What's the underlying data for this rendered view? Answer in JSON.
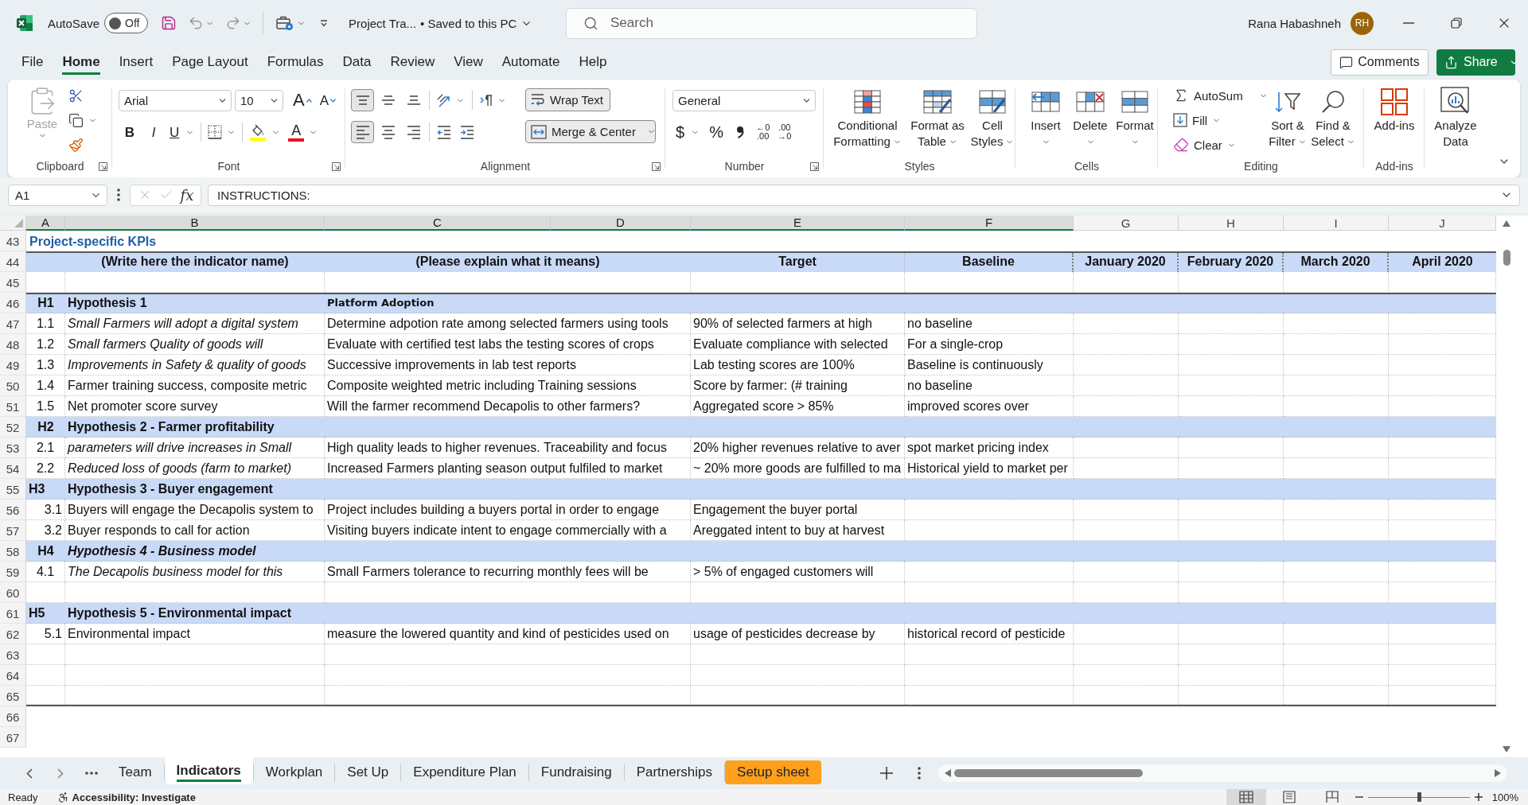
{
  "title_bar": {
    "autosave": "AutoSave",
    "autosave_toggle": {
      "label": "Off",
      "on": false
    },
    "document": "Project Tra...",
    "save_status": "• Saved to this PC",
    "search": {
      "placeholder": "Search"
    },
    "user": {
      "name": "Rana Habashneh",
      "initials": "RH"
    }
  },
  "menu": {
    "tabs": [
      {
        "label": "File",
        "selected": false
      },
      {
        "label": "Home",
        "selected": true
      },
      {
        "label": "Insert",
        "selected": false
      },
      {
        "label": "Page Layout",
        "selected": false
      },
      {
        "label": "Formulas",
        "selected": false
      },
      {
        "label": "Data",
        "selected": false
      },
      {
        "label": "Review",
        "selected": false
      },
      {
        "label": "View",
        "selected": false
      },
      {
        "label": "Automate",
        "selected": false
      },
      {
        "label": "Help",
        "selected": false
      }
    ],
    "comments": "Comments",
    "share": "Share"
  },
  "ribbon": {
    "clipboard": {
      "label": "Clipboard",
      "paste": {
        "label": "Paste",
        "disabled": true
      }
    },
    "font": {
      "label": "Font",
      "name": "Arial",
      "size": "10",
      "grow": "A",
      "shrink": "A",
      "bold": "B",
      "italic": "I",
      "underline": "U",
      "font_color": "A"
    },
    "alignment": {
      "label": "Alignment",
      "vertical": [
        {
          "kind": "top",
          "pressed": true
        },
        {
          "kind": "middle",
          "pressed": false
        },
        {
          "kind": "bottom",
          "pressed": false
        }
      ],
      "horizontal": [
        {
          "kind": "left",
          "pressed": true
        },
        {
          "kind": "center",
          "pressed": false
        },
        {
          "kind": "right",
          "pressed": false
        }
      ],
      "wrap_text": {
        "label": "Wrap Text",
        "pressed": true
      },
      "merge": {
        "label": "Merge & Center",
        "pressed": true
      }
    },
    "number": {
      "label": "Number",
      "format": "General",
      "currency": "$",
      "percent": "%",
      "decimals": [
        {
          "upper": "←0",
          "lower": ".00"
        },
        {
          "upper": ".00",
          "lower": "→0"
        }
      ]
    },
    "styles": {
      "label": "Styles",
      "buttons": [
        {
          "kind": "conditional",
          "lines": [
            "Conditional",
            "Formatting"
          ]
        },
        {
          "kind": "table",
          "lines": [
            "Format as",
            "Table"
          ]
        },
        {
          "kind": "cell_styles",
          "lines": [
            "Cell",
            "Styles"
          ]
        }
      ]
    },
    "cells": {
      "label": "Cells",
      "buttons": [
        {
          "kind": "insert",
          "label": "Insert"
        },
        {
          "kind": "delete",
          "label": "Delete"
        },
        {
          "kind": "format",
          "label": "Format"
        }
      ]
    },
    "editing": {
      "label": "Editing",
      "small": [
        {
          "kind": "autosum",
          "label": "AutoSum"
        },
        {
          "kind": "fill",
          "label": "Fill"
        },
        {
          "kind": "clear",
          "label": "Clear"
        }
      ],
      "large": [
        {
          "kind": "sort",
          "lines": [
            "Sort &",
            "Filter"
          ]
        },
        {
          "kind": "find",
          "lines": [
            "Find &",
            "Select"
          ]
        }
      ]
    },
    "addins": {
      "label": "Add-ins",
      "button": "Add-ins"
    },
    "analyze": {
      "lines": [
        "Analyze",
        "Data"
      ]
    }
  },
  "formula_bar": {
    "name_box": "A1",
    "fx": "fx",
    "formula": "INSTRUCTIONS:"
  },
  "sheet": {
    "columns": [
      {
        "label": "A",
        "selected": true
      },
      {
        "label": "B",
        "selected": true
      },
      {
        "label": "C",
        "selected": true
      },
      {
        "label": "D",
        "selected": true
      },
      {
        "label": "E",
        "selected": true
      },
      {
        "label": "F",
        "selected": true
      },
      {
        "label": "G",
        "selected": false
      },
      {
        "label": "H",
        "selected": false
      },
      {
        "label": "I",
        "selected": false
      },
      {
        "label": "J",
        "selected": false
      }
    ],
    "rows": [
      {
        "number": "43",
        "kind": "title",
        "a": "Project-specific KPIs"
      },
      {
        "number": "44",
        "kind": "header",
        "thick_top": true,
        "b": "(Write here the indicator name)",
        "c": "(Please explain what it means)",
        "e": "Target",
        "f": "Baseline",
        "g": "January 2020",
        "h": "February 2020",
        "i": "March 2020",
        "j": "April 2020"
      },
      {
        "number": "45",
        "kind": "blank"
      },
      {
        "number": "46",
        "kind": "group",
        "thick_top": true,
        "a": "H1",
        "a_centered": true,
        "b": "Hypothesis 1",
        "b_italic": false,
        "c": "Platform Adoption"
      },
      {
        "number": "47",
        "kind": "item",
        "a": "1.1",
        "a_centered": true,
        "b": "Small Farmers will adopt a digital system",
        "b_italic": true,
        "c": "Determine adpotion rate among selected farmers using tools",
        "e": "90% of selected farmers at high",
        "f": "no baseline"
      },
      {
        "number": "48",
        "kind": "item",
        "a": "1.2",
        "a_centered": true,
        "b": "Small farmers Quality of goods will",
        "b_italic": true,
        "c": "Evaluate with certified test labs the testing scores of crops",
        "e": "Evaluate compliance with selected",
        "f": "For a single-crop"
      },
      {
        "number": "49",
        "kind": "item",
        "a": "1.3",
        "a_centered": true,
        "b": "Improvements in Safety & quality of goods",
        "b_italic": true,
        "c": "Successive improvements in lab test reports",
        "e": "Lab testing scores are 100%",
        "f": "Baseline is continuously"
      },
      {
        "number": "50",
        "kind": "item",
        "a": "1.4",
        "a_centered": true,
        "b": "Farmer training success, composite metric",
        "b_italic": false,
        "c": "Composite weighted metric including Training sessions",
        "e": "Score by farmer: (# training",
        "f": "no baseline"
      },
      {
        "number": "51",
        "kind": "item",
        "a": "1.5",
        "a_centered": true,
        "b": "Net promoter score survey",
        "b_italic": false,
        "c": "Will the farmer recommend Decapolis to other farmers?",
        "e": "Aggregated score > 85%",
        "f": "improved scores over"
      },
      {
        "number": "52",
        "kind": "group",
        "a": "H2",
        "a_centered": true,
        "b": "Hypothesis 2 - Farmer profitability",
        "b_italic": false
      },
      {
        "number": "53",
        "kind": "item",
        "a": "2.1",
        "a_centered": true,
        "b": "parameters will drive increases in Small",
        "b_italic": true,
        "c": "High quality leads to higher revenues. Traceability and focus",
        "e": "20% higher revenues relative to aver",
        "f": "spot market pricing index"
      },
      {
        "number": "54",
        "kind": "item",
        "a": "2.2",
        "a_centered": true,
        "b": "Reduced loss of goods (farm to market)",
        "b_italic": true,
        "c": "Increased Farmers planting season output fulfiled to market",
        "e": "~ 20% more goods are fulfilled to ma",
        "f": "Historical yield to market per"
      },
      {
        "number": "55",
        "kind": "group",
        "a": "H3",
        "a_centered": false,
        "b": "Hypothesis 3 - Buyer engagement",
        "b_italic": false
      },
      {
        "number": "56",
        "kind": "item",
        "a": "3.1",
        "a_centered": false,
        "b": "Buyers will engage the Decapolis system to",
        "b_italic": false,
        "c": "Project includes building a buyers portal in order to engage",
        "e": "Engagement the buyer portal"
      },
      {
        "number": "57",
        "kind": "item",
        "a": "3.2",
        "a_centered": false,
        "b": "Buyer responds to call for action",
        "b_italic": false,
        "c": "Visiting buyers indicate intent to engage commercially with a",
        "e": "Areggated intent to buy at harvest"
      },
      {
        "number": "58",
        "kind": "group",
        "a": "H4",
        "a_centered": true,
        "b": "Hypothesis 4 - Business model",
        "b_italic": true
      },
      {
        "number": "59",
        "kind": "item",
        "a": "4.1",
        "a_centered": true,
        "b": "The Decapolis business model for this",
        "b_italic": true,
        "c": "Small Farmers tolerance to recurring monthly fees will be",
        "e": "> 5% of engaged customers will"
      },
      {
        "number": "60",
        "kind": "blank"
      },
      {
        "number": "61",
        "kind": "group",
        "a": "H5",
        "a_centered": false,
        "b": "Hypothesis 5 - Environmental impact",
        "b_italic": false
      },
      {
        "number": "62",
        "kind": "item",
        "a": "5.1",
        "a_centered": false,
        "b": "Environmental impact",
        "b_italic": false,
        "c": "measure the lowered quantity and kind of pesticides used on",
        "e": "usage of pesticides decrease by",
        "f": "historical record of pesticide"
      },
      {
        "number": "63",
        "kind": "blank"
      },
      {
        "number": "64",
        "kind": "blank"
      },
      {
        "number": "65",
        "kind": "blank",
        "thick_bottom": true
      },
      {
        "number": "66",
        "kind": "empty"
      },
      {
        "number": "67",
        "kind": "empty"
      }
    ]
  },
  "sheet_tabs": [
    {
      "label": "Team",
      "selected": false
    },
    {
      "label": "Indicators",
      "selected": true
    },
    {
      "label": "Workplan",
      "selected": false
    },
    {
      "label": "Set Up",
      "selected": false
    },
    {
      "label": "Expenditure Plan",
      "selected": false
    },
    {
      "label": "Fundraising",
      "selected": false
    },
    {
      "label": "Partnerships",
      "selected": false
    },
    {
      "label": "Setup sheet",
      "selected": false,
      "color": "#ffa01c"
    }
  ],
  "status_bar": {
    "mode": "Ready",
    "accessibility": "Accessibility: Investigate",
    "views": [
      {
        "kind": "normal",
        "selected": true
      },
      {
        "kind": "page_layout",
        "selected": false
      },
      {
        "kind": "page_break",
        "selected": false
      }
    ],
    "zoom": {
      "level": 0.5,
      "reading": "100%"
    }
  }
}
